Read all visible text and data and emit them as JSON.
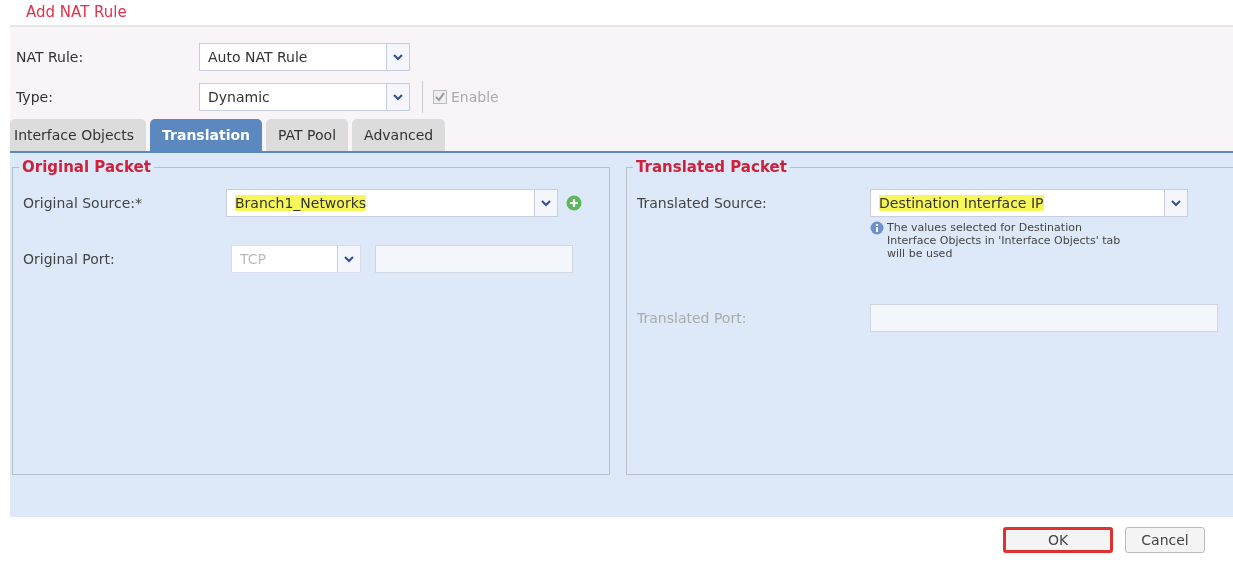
{
  "window": {
    "title": "Add NAT Rule"
  },
  "header_fields": [
    {
      "label": "NAT Rule:",
      "value": "Auto NAT Rule"
    },
    {
      "label": "Type:",
      "value": "Dynamic"
    }
  ],
  "enable": {
    "label": "Enable",
    "checked": true,
    "disabled": true
  },
  "tabs": [
    {
      "label": "Interface Objects",
      "selected": false
    },
    {
      "label": "Translation",
      "selected": true
    },
    {
      "label": "PAT Pool",
      "selected": false
    },
    {
      "label": "Advanced",
      "selected": false
    }
  ],
  "original_packet": {
    "title": "Original Packet",
    "source": {
      "label": "Original Source:*",
      "value": "Branch1_Networks",
      "highlighted": true
    },
    "port": {
      "label": "Original Port:",
      "protocol": "TCP",
      "disabled": true
    }
  },
  "translated_packet": {
    "title": "Translated Packet",
    "source": {
      "label": "Translated Source:",
      "value": "Destination Interface IP",
      "highlighted": true
    },
    "note": "The values selected for Destination Interface Objects in 'Interface Objects' tab will be used",
    "port": {
      "label": "Translated Port:",
      "disabled": true
    }
  },
  "buttons": [
    {
      "label": "OK",
      "highlighted": true
    },
    {
      "label": "Cancel",
      "highlighted": false
    }
  ]
}
